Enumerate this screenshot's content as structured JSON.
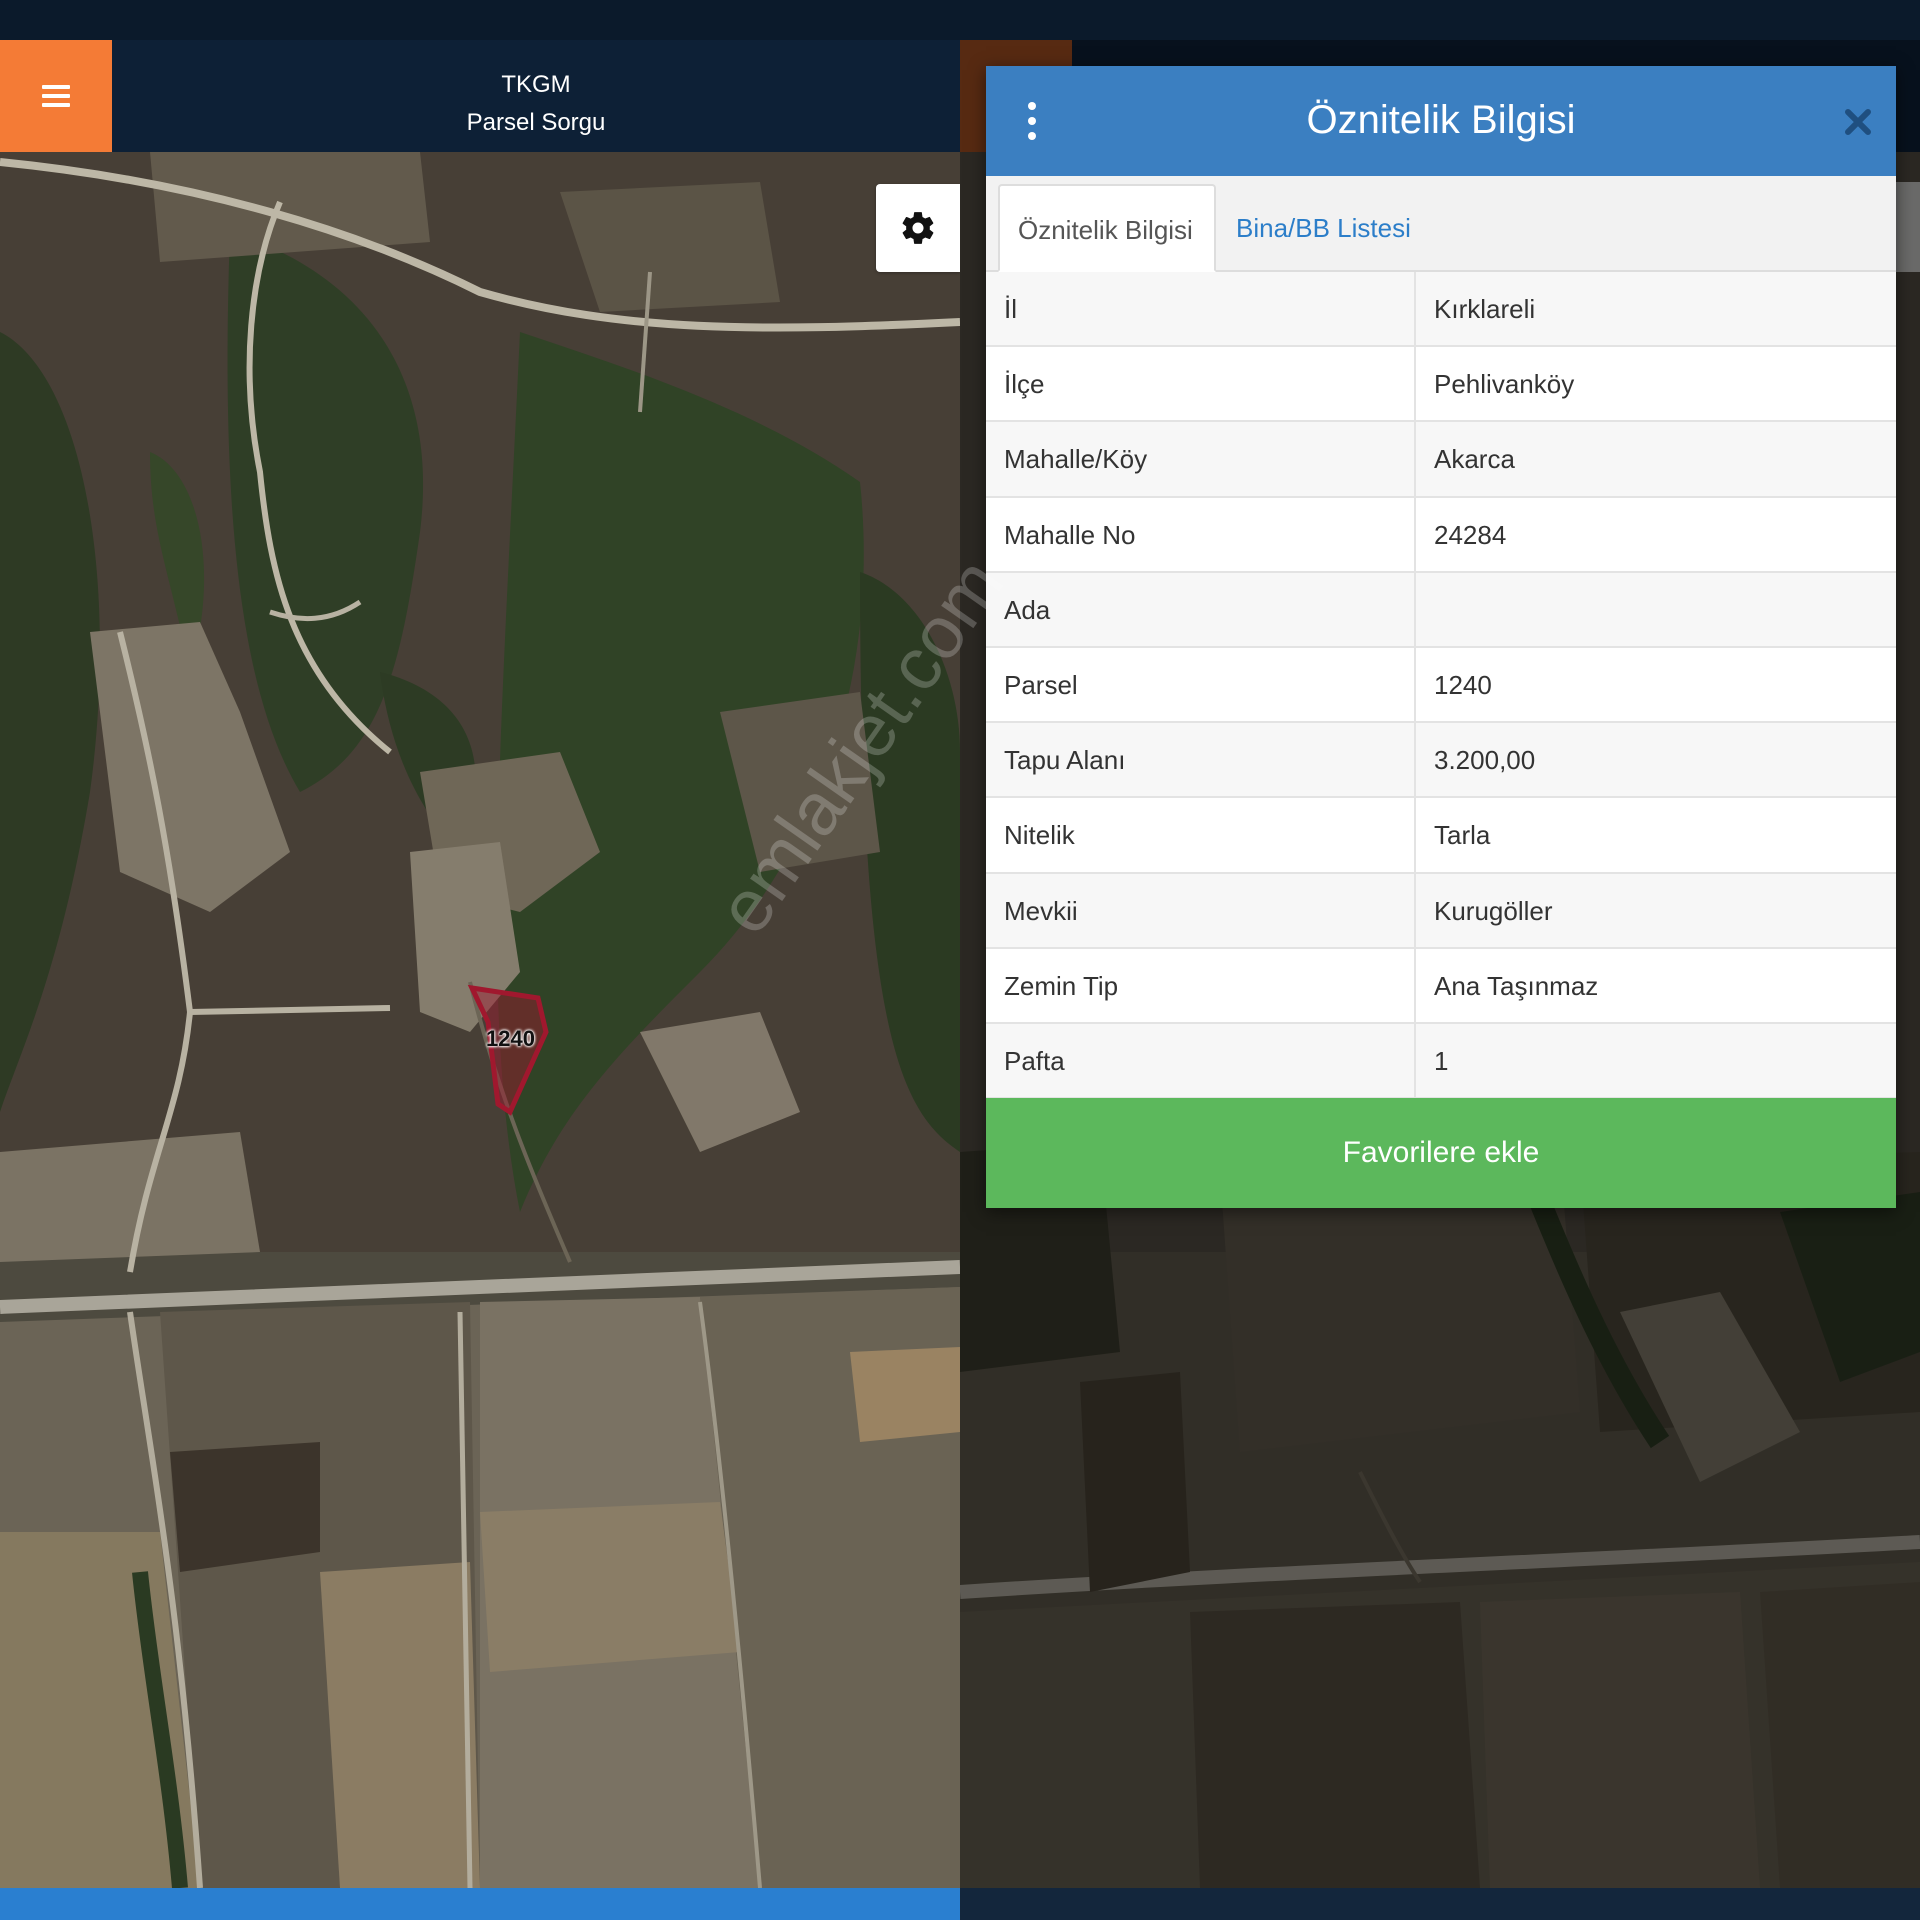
{
  "header": {
    "app_name": "TKGM",
    "subtitle": "Parsel Sorgu"
  },
  "icons": {
    "menu": "hamburger-menu-icon",
    "settings": "gear-icon",
    "kebab": "vertical-dots-icon",
    "close": "close-icon"
  },
  "map": {
    "parcel_label": "1240",
    "parcel_outline_color": "#a0182e"
  },
  "modal": {
    "title": "Öznitelik Bilgisi",
    "tabs": [
      {
        "label": "Öznitelik Bilgisi",
        "active": true
      },
      {
        "label": "Bina/BB Listesi",
        "active": false
      }
    ],
    "rows": [
      {
        "key": "İl",
        "value": "Kırklareli"
      },
      {
        "key": "İlçe",
        "value": "Pehlivanköy"
      },
      {
        "key": "Mahalle/Köy",
        "value": "Akarca"
      },
      {
        "key": "Mahalle No",
        "value": "24284"
      },
      {
        "key": "Ada",
        "value": ""
      },
      {
        "key": "Parsel",
        "value": "1240"
      },
      {
        "key": "Tapu Alanı",
        "value": "3.200,00"
      },
      {
        "key": "Nitelik",
        "value": "Tarla"
      },
      {
        "key": "Mevkii",
        "value": "Kurugöller"
      },
      {
        "key": "Zemin Tip",
        "value": "Ana Taşınmaz"
      },
      {
        "key": "Pafta",
        "value": "1"
      }
    ],
    "favorite_button": "Favorilere ekle"
  },
  "watermark": "emlakjet.com",
  "colors": {
    "menu_orange": "#f47b36",
    "header_navy": "#0d2036",
    "modal_blue": "#3b7fc1",
    "tab_link_blue": "#2c7ec9",
    "favorite_green": "#5cb85c"
  }
}
